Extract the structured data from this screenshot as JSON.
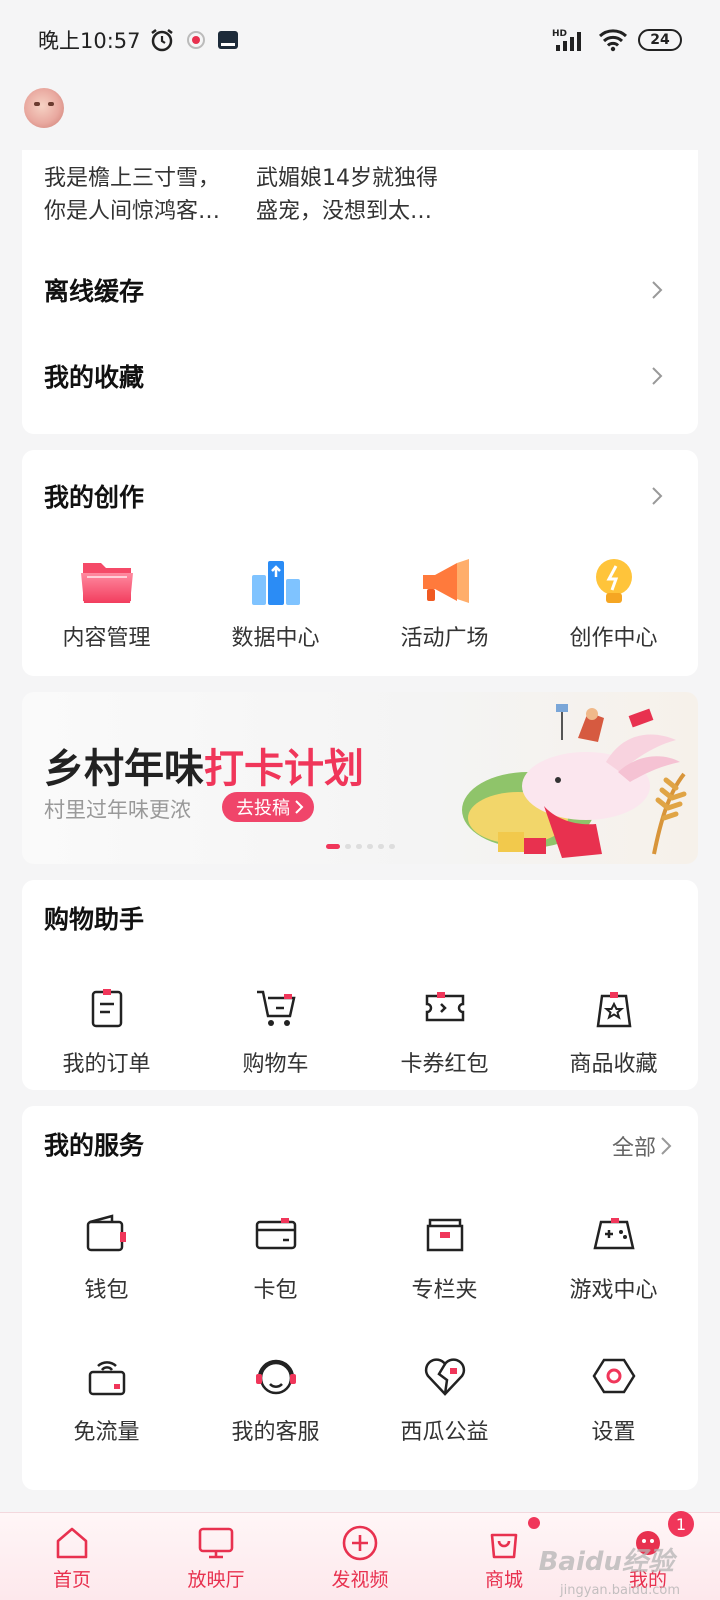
{
  "status_bar": {
    "time": "晚上10:57",
    "battery": "24",
    "network": "HD"
  },
  "previews": [
    {
      "line1": "我是檐上三寸雪，",
      "line2": "你是人间惊鸿客…"
    },
    {
      "line1": "武媚娘14岁就独得",
      "line2": "盛宠，没想到太…"
    }
  ],
  "menu": {
    "offline_cache": "离线缓存",
    "favorites": "我的收藏"
  },
  "creation": {
    "title": "我的创作",
    "items": [
      {
        "label": "内容管理",
        "icon": "folder-icon"
      },
      {
        "label": "数据中心",
        "icon": "data-chart-icon"
      },
      {
        "label": "活动广场",
        "icon": "megaphone-icon"
      },
      {
        "label": "创作中心",
        "icon": "lightbulb-icon"
      }
    ]
  },
  "banner": {
    "title_plain": "乡村年味",
    "title_highlight": "打卡计划",
    "subtitle": "村里过年味更浓",
    "button": "去投稿"
  },
  "shopping": {
    "title": "购物助手",
    "items": [
      {
        "label": "我的订单",
        "icon": "order-icon"
      },
      {
        "label": "购物车",
        "icon": "cart-icon"
      },
      {
        "label": "卡券红包",
        "icon": "coupon-icon"
      },
      {
        "label": "商品收藏",
        "icon": "product-favorite-icon"
      }
    ]
  },
  "services": {
    "title": "我的服务",
    "all": "全部",
    "items": [
      {
        "label": "钱包",
        "icon": "wallet-icon"
      },
      {
        "label": "卡包",
        "icon": "card-holder-icon"
      },
      {
        "label": "专栏夹",
        "icon": "column-folder-icon"
      },
      {
        "label": "游戏中心",
        "icon": "gamepad-icon"
      },
      {
        "label": "免流量",
        "icon": "free-data-icon"
      },
      {
        "label": "我的客服",
        "icon": "headset-icon"
      },
      {
        "label": "西瓜公益",
        "icon": "charity-heart-icon"
      },
      {
        "label": "设置",
        "icon": "settings-icon"
      }
    ]
  },
  "tabbar": {
    "items": [
      {
        "label": "首页",
        "icon": "home-icon"
      },
      {
        "label": "放映厅",
        "icon": "tv-icon"
      },
      {
        "label": "发视频",
        "icon": "add-video-icon"
      },
      {
        "label": "商城",
        "icon": "shopping-bag-icon"
      },
      {
        "label": "我的",
        "icon": "profile-icon"
      }
    ],
    "profile_badge": "1"
  },
  "watermark": {
    "logo": "Baidu经验",
    "url": "jingyan.baidu.com"
  },
  "colors": {
    "accent": "#f0365a",
    "background": "#f5f5f6",
    "card": "#ffffff"
  }
}
